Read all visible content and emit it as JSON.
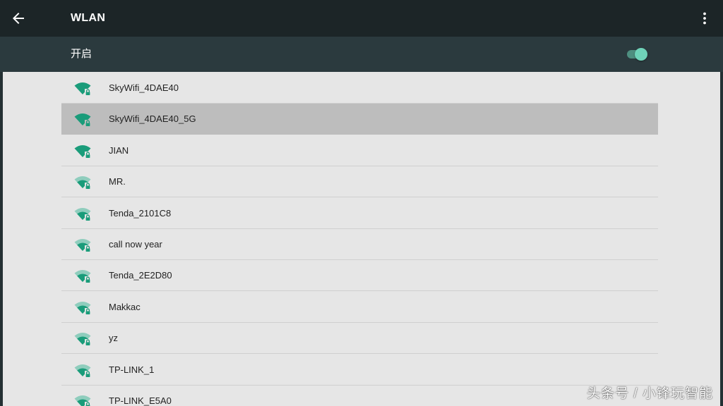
{
  "appbar": {
    "title": "WLAN"
  },
  "switch": {
    "label": "开启",
    "enabled": true
  },
  "networks": [
    {
      "name": "SkyWifi_4DAE40",
      "signal": "full",
      "secured": true,
      "selected": false
    },
    {
      "name": "SkyWifi_4DAE40_5G",
      "signal": "full",
      "secured": true,
      "selected": true
    },
    {
      "name": "JIAN",
      "signal": "full",
      "secured": true,
      "selected": false
    },
    {
      "name": "MR.",
      "signal": "medium",
      "secured": true,
      "selected": false
    },
    {
      "name": "Tenda_2101C8",
      "signal": "medium",
      "secured": true,
      "selected": false
    },
    {
      "name": "call now year",
      "signal": "medium",
      "secured": true,
      "selected": false
    },
    {
      "name": "Tenda_2E2D80",
      "signal": "medium",
      "secured": true,
      "selected": false
    },
    {
      "name": "Makkac",
      "signal": "medium",
      "secured": true,
      "selected": false
    },
    {
      "name": "yz",
      "signal": "medium",
      "secured": true,
      "selected": false
    },
    {
      "name": "TP-LINK_1",
      "signal": "medium",
      "secured": true,
      "selected": false
    },
    {
      "name": "TP-LINK_E5A0",
      "signal": "medium",
      "secured": true,
      "selected": false
    }
  ],
  "icons": {
    "back": "arrow-back-icon",
    "menu": "more-vert-icon",
    "wifi": "wifi-lock-icon"
  },
  "colors": {
    "accent": "#1a9c7a",
    "accent_light": "#8fcdbd",
    "selected_row": "#bdbdbd"
  },
  "watermark": {
    "text": "头条号 / 小锋玩智能"
  }
}
